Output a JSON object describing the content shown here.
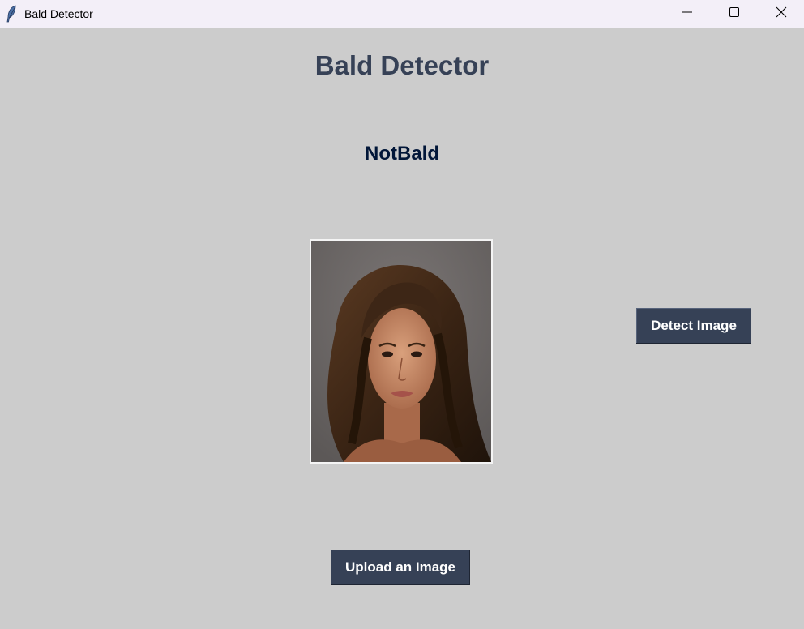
{
  "window": {
    "title": "Bald Detector",
    "icon": "feather-icon",
    "controls": [
      "minimize-icon",
      "maximize-icon",
      "close-icon"
    ]
  },
  "main": {
    "heading": "Bald Detector",
    "result": "NotBald",
    "image": {
      "description_icon": "portrait-photo"
    },
    "detect_button_label": "Detect Image",
    "upload_button_label": "Upload an Image"
  },
  "colors": {
    "background": "#cccccc",
    "heading": "#364156",
    "result": "#011638",
    "button_bg": "#364156",
    "button_text": "#ffffff",
    "titlebar": "#f3eff8"
  }
}
